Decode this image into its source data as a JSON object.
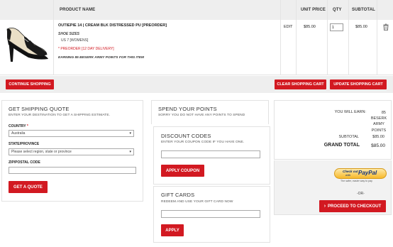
{
  "table": {
    "headers": {
      "product": "PRODUCT NAME",
      "unit_price": "UNIT PRICE",
      "qty": "QTY",
      "subtotal": "SUBTOTAL"
    },
    "item": {
      "name": "OUTIEPIE 14 | CREAM BLK DISTRESSED PU [PREORDER]",
      "option_label": "SHOE SIZES",
      "option_value": "US 7 [WOMENS]",
      "preorder": "* PREORDER [12 DAY DELIVERY]",
      "points_note": "EARNING 85 BESERK ARMY POINTS FOR THIS ITEM",
      "edit": "EDIT",
      "unit_price": "$85.00",
      "qty": "1",
      "subtotal": "$85.00"
    }
  },
  "actions": {
    "continue": "CONTINUE SHOPPING",
    "clear": "CLEAR SHOPPING CART",
    "update": "UPDATE SHOPPING CART"
  },
  "shipping": {
    "title": "GET SHIPPING QUOTE",
    "desc": "ENTER YOUR DESTINATION TO GET A SHIPPING ESTIMATE.",
    "country_label": "COUNTRY",
    "country_required": "*",
    "country_value": "Australia",
    "state_label": "STATE/PROVINCE",
    "state_value": "Please select region, state or province",
    "zip_label": "ZIP/POSTAL CODE",
    "button": "GET A QUOTE"
  },
  "points": {
    "title": "SPEND YOUR POINTS",
    "desc": "SORRY YOU DO NOT HAVE ANY POINTS TO SPEND"
  },
  "discount": {
    "title": "DISCOUNT CODES",
    "desc": "ENTER YOUR COUPON CODE IF YOU HAVE ONE.",
    "button": "APPLY COUPON"
  },
  "gift": {
    "title": "GIFT CARDS",
    "desc": "REDEEM AND USE YOUR GIFT CARD NOW",
    "button": "APPLY"
  },
  "totals": {
    "earn_label": "YOU WILL EARN:",
    "earn_line1": "85",
    "earn_line2": "BESERK",
    "earn_line3": "ARMY",
    "earn_line4": "POINTS",
    "subtotal_label": "SUBTOTAL",
    "subtotal_value": "$85.00",
    "grand_label": "GRAND TOTAL",
    "grand_value": "$85.00",
    "paypal_top": "Check out",
    "paypal_with": "with",
    "paypal_brand": "PayPal",
    "paypal_tagline": "The safer, easier way to pay",
    "or": "-OR-",
    "checkout": "PROCEED TO CHECKOUT",
    "checkout_arrow": "›"
  }
}
